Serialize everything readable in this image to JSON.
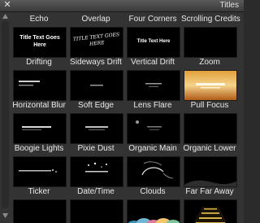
{
  "window": {
    "title": "Titles",
    "close_glyph": "✕"
  },
  "scrollbar": {
    "up": "scroll-up-arrow",
    "down": "scroll-down-arrow"
  },
  "tiles": [
    {
      "label": "Echo",
      "thumb_text": "Title Text Goes Here"
    },
    {
      "label": "Overlap",
      "thumb_text": "TITLE TEXT GOES HERE"
    },
    {
      "label": "Four Corners",
      "thumb_text": "Title Text Here"
    },
    {
      "label": "Scrolling Credits",
      "thumb_text": ""
    },
    {
      "label": "Drifting",
      "thumb_text": ""
    },
    {
      "label": "Sideways Drift",
      "thumb_text": ""
    },
    {
      "label": "Vertical Drift",
      "thumb_text": ""
    },
    {
      "label": "Zoom",
      "thumb_text": ""
    },
    {
      "label": "Horizontal Blur",
      "thumb_text": ""
    },
    {
      "label": "Soft Edge",
      "thumb_text": ""
    },
    {
      "label": "Lens Flare",
      "thumb_text": ""
    },
    {
      "label": "Pull Focus",
      "thumb_text": ""
    },
    {
      "label": "Boogie Lights",
      "thumb_text": ""
    },
    {
      "label": "Pixie Dust",
      "thumb_text": ""
    },
    {
      "label": "Organic Main",
      "thumb_text": ""
    },
    {
      "label": "Organic Lower",
      "thumb_text": ""
    },
    {
      "label": "Ticker",
      "thumb_text": ""
    },
    {
      "label": "Date/Time",
      "thumb_text": ""
    },
    {
      "label": "Clouds",
      "thumb_text": ""
    },
    {
      "label": "Far Far Away",
      "thumb_text": ""
    }
  ]
}
